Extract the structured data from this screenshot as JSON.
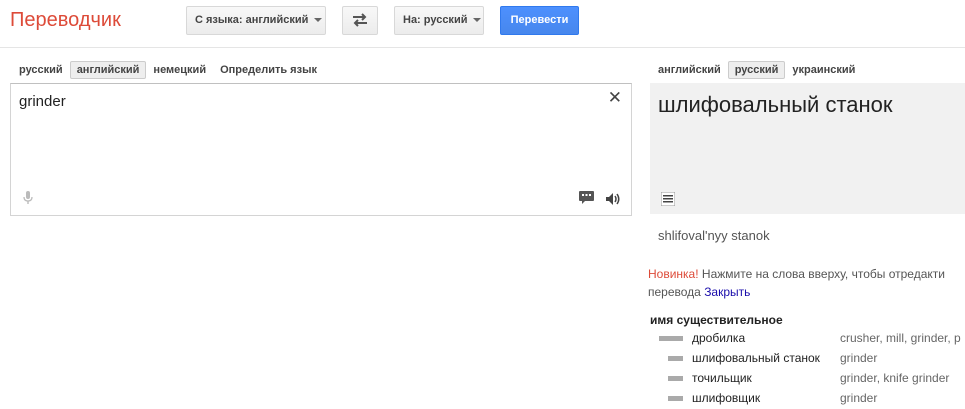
{
  "header": {
    "logo": "Переводчик",
    "from_select": "С языка: английский",
    "to_select": "На: русский",
    "translate_button": "Перевести"
  },
  "source": {
    "langs": [
      "русский",
      "английский",
      "немецкий",
      "Определить язык"
    ],
    "active_lang": "английский",
    "text": "grinder"
  },
  "target": {
    "langs": [
      "английский",
      "русский",
      "украинский"
    ],
    "active_lang": "русский",
    "text": "шлифовальный станок",
    "transliteration": "shlifoval'nyy stanok"
  },
  "notice": {
    "new_label": "Новинка!",
    "text": " Нажмите на слова вверху, чтобы отредакти",
    "line2": "перевода ",
    "close_link": "Закрыть"
  },
  "dictionary": {
    "part_of_speech": "имя существительное",
    "entries": [
      {
        "word": "дробилка",
        "synonyms": "crusher, mill, grinder, p",
        "frequency": 1.0
      },
      {
        "word": "шлифовальный станок",
        "synonyms": "grinder",
        "frequency": 0.6
      },
      {
        "word": "точильщик",
        "synonyms": "grinder, knife grinder",
        "frequency": 0.6
      },
      {
        "word": "шлифовщик",
        "synonyms": "grinder",
        "frequency": 0.6
      }
    ]
  },
  "icons": {
    "swap": "swap-arrows-icon",
    "clear": "close-icon",
    "mic": "microphone-icon",
    "keyboard": "chat-bubble-icon",
    "speaker": "speaker-icon",
    "list": "list-icon"
  },
  "colors": {
    "brand": "#dd4b39",
    "primary_button": "#4d90fe",
    "link": "#1a0dab"
  }
}
